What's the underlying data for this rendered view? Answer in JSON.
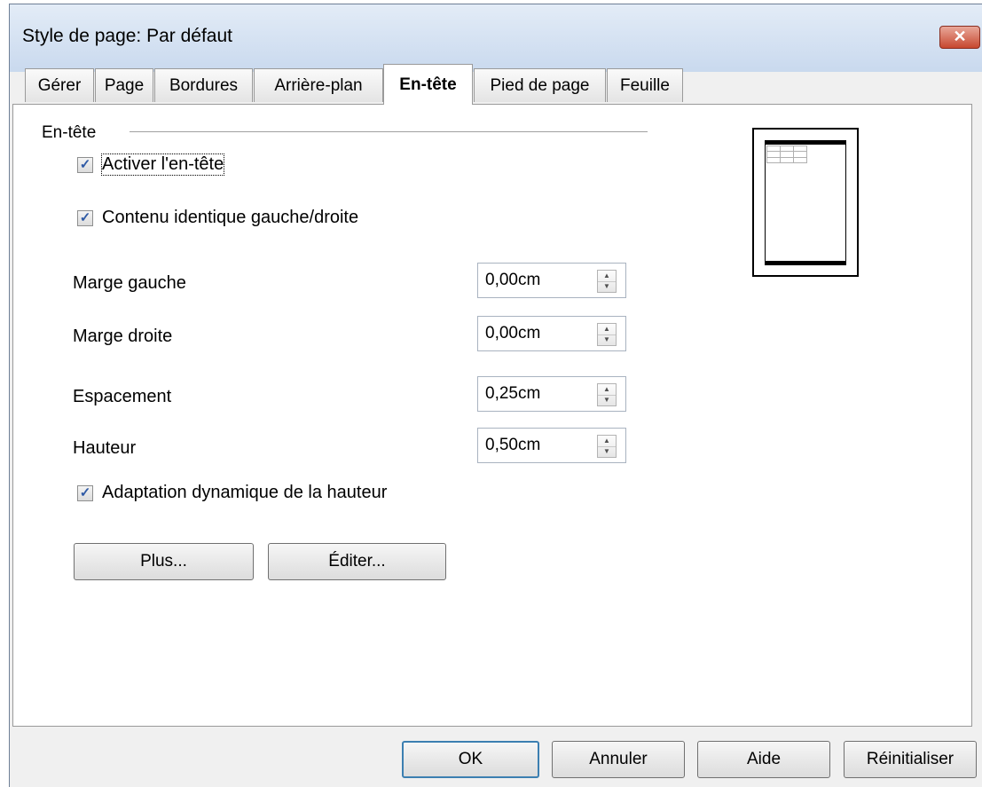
{
  "window": {
    "title": "Style de page: Par défaut",
    "close_glyph": "✕"
  },
  "tabs": [
    {
      "label": "Gérer",
      "active": false
    },
    {
      "label": "Page",
      "active": false
    },
    {
      "label": "Bordures",
      "active": false
    },
    {
      "label": "Arrière-plan",
      "active": false
    },
    {
      "label": "En-tête",
      "active": true
    },
    {
      "label": "Pied de page",
      "active": false
    },
    {
      "label": "Feuille",
      "active": false
    }
  ],
  "header_section": {
    "group_label": "En-tête",
    "enable_header": {
      "label": "Activer l'en-tête",
      "checked": true
    },
    "same_content": {
      "label": "Contenu identique gauche/droite",
      "checked": true
    },
    "left_margin": {
      "label": "Marge gauche",
      "value": "0,00cm"
    },
    "right_margin": {
      "label": "Marge droite",
      "value": "0,00cm"
    },
    "spacing": {
      "label": "Espacement",
      "value": "0,25cm"
    },
    "height": {
      "label": "Hauteur",
      "value": "0,50cm"
    },
    "autofit_height": {
      "label": "Adaptation dynamique de la hauteur",
      "checked": true
    },
    "more_button": "Plus...",
    "edit_button": "Éditer..."
  },
  "footer_buttons": {
    "ok": "OK",
    "cancel": "Annuler",
    "help": "Aide",
    "reset": "Réinitialiser"
  },
  "check_glyph": "✓",
  "colors": {
    "title_bar": "#c9d9ee",
    "close_button": "#c7472f",
    "default_button_border": "#3c7fb1"
  }
}
